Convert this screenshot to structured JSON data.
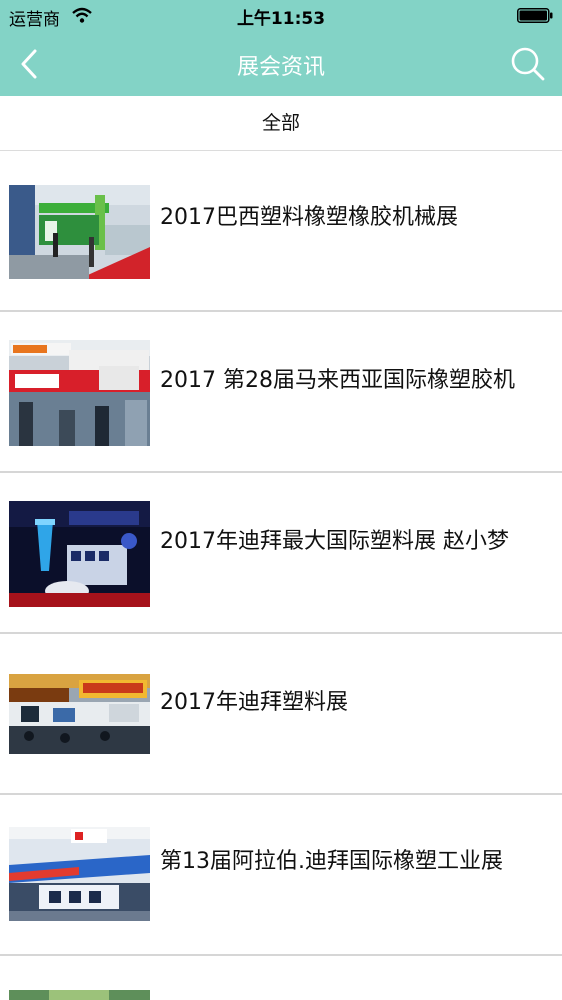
{
  "status_bar": {
    "carrier": "运营商",
    "time": "上午11:53",
    "icons": [
      "wifi-icon",
      "battery-icon"
    ]
  },
  "nav": {
    "title": "展会资讯",
    "back_icon": "chevron-left-icon",
    "search_icon": "search-icon"
  },
  "filter": {
    "label": "全部"
  },
  "articles": [
    {
      "title": "2017巴西塑料橡塑橡胶机械展"
    },
    {
      "title": "2017 第28届马来西亚国际橡塑胶机"
    },
    {
      "title": "2017年迪拜最大国际塑料展 赵小梦"
    },
    {
      "title": "2017年迪拜塑料展"
    },
    {
      "title": "第13届阿拉伯.迪拜国际橡塑工业展"
    }
  ],
  "colors": {
    "header": "#83d3c6",
    "title_text": "#ffffff",
    "divider": "#d6d6d6"
  }
}
